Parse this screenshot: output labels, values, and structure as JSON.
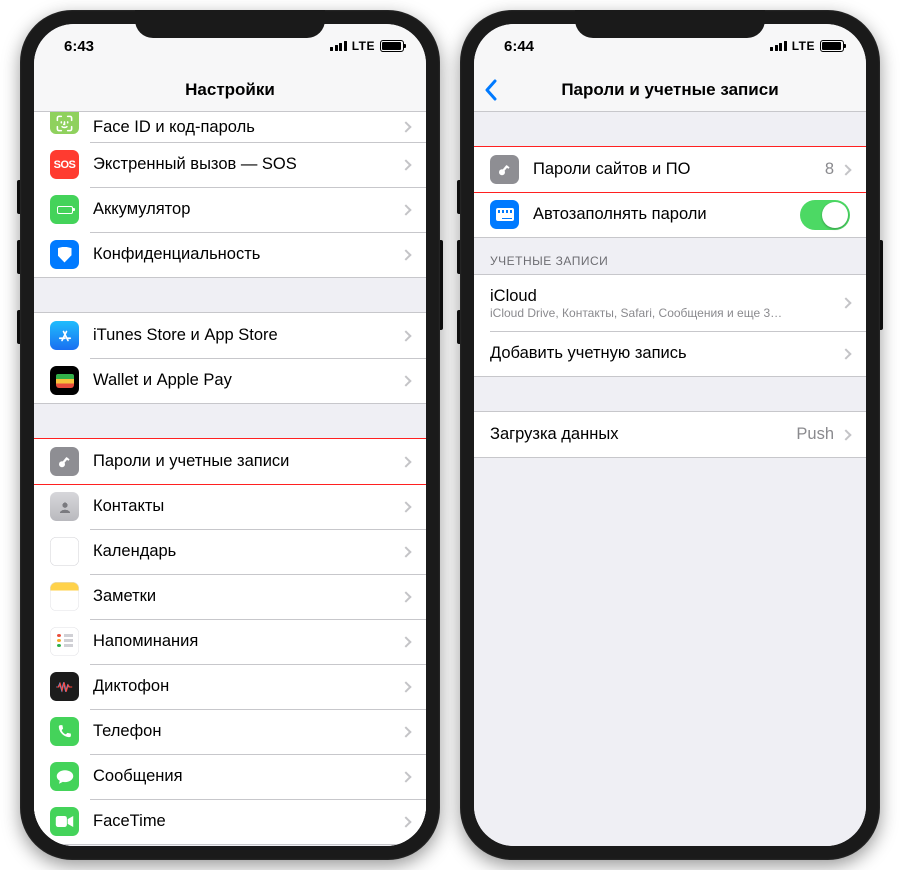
{
  "left": {
    "status": {
      "time": "6:43",
      "carrier": "LTE"
    },
    "title": "Настройки",
    "rows": {
      "faceid": "Face ID и код-пароль",
      "sos": "Экстренный вызов — SOS",
      "battery": "Аккумулятор",
      "privacy": "Конфиденциальность",
      "appstore": "iTunes Store и App Store",
      "wallet": "Wallet и Apple Pay",
      "passwords": "Пароли и учетные записи",
      "contacts": "Контакты",
      "calendar": "Календарь",
      "notes": "Заметки",
      "reminders": "Напоминания",
      "voice": "Диктофон",
      "phone": "Телефон",
      "messages": "Сообщения",
      "facetime": "FaceTime"
    }
  },
  "right": {
    "status": {
      "time": "6:44",
      "carrier": "LTE"
    },
    "title": "Пароли и учетные записи",
    "rows": {
      "site_pw": "Пароли сайтов и ПО",
      "site_pw_count": "8",
      "autofill": "Автозаполнять пароли",
      "section_accounts": "УЧЕТНЫЕ ЗАПИСИ",
      "icloud": "iCloud",
      "icloud_sub": "iCloud Drive, Контакты, Safari, Сообщения и еще 3…",
      "add": "Добавить учетную запись",
      "fetch": "Загрузка данных",
      "fetch_val": "Push"
    }
  }
}
